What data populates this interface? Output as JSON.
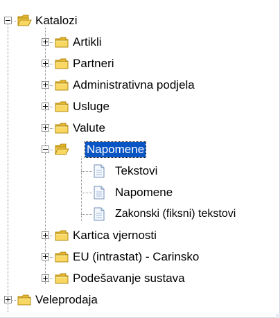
{
  "tree": {
    "root_label": "Katalozi",
    "children": [
      {
        "label": "Artikli"
      },
      {
        "label": "Partneri"
      },
      {
        "label": "Administrativna podjela"
      },
      {
        "label": "Usluge"
      },
      {
        "label": "Valute"
      },
      {
        "label": "Napomene"
      },
      {
        "label": "Tekstovi"
      },
      {
        "label": "Napomene"
      },
      {
        "label": "Zakonski (fiksni) tekstovi"
      },
      {
        "label": "Kartica vjernosti"
      },
      {
        "label": "EU (intrastat) - Carinsko"
      },
      {
        "label": "Podešavanje sustava"
      }
    ],
    "sibling_label": "Veleprodaja",
    "selected_item": "Napomene"
  },
  "colors": {
    "selection": "#0a55c4",
    "folder": "#f5d25a",
    "document": "#dce9f7"
  }
}
